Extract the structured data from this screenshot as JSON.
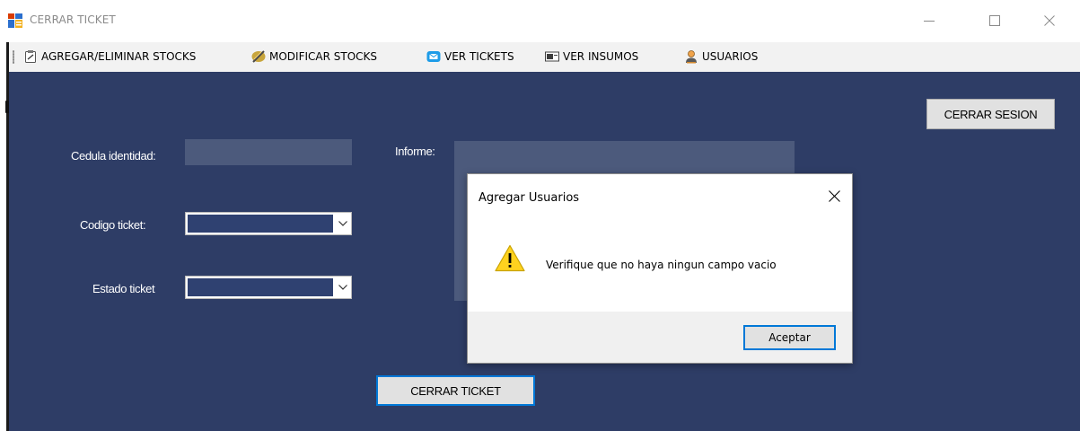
{
  "window": {
    "title": "CERRAR TICKET",
    "accent_color": "#0078d7",
    "panel_color": "#2e3d66"
  },
  "menu": {
    "items": [
      {
        "label": "AGREGAR/ELIMINAR STOCKS",
        "icon": "clipboard-icon"
      },
      {
        "label": "MODIFICAR STOCKS",
        "icon": "pencil-icon"
      },
      {
        "label": "VER TICKETS",
        "icon": "mail-icon"
      },
      {
        "label": "VER INSUMOS",
        "icon": "card-icon"
      },
      {
        "label": "USUARIOS",
        "icon": "user-icon"
      }
    ]
  },
  "form": {
    "cedula_label": "Cedula identidad:",
    "cedula_value": "",
    "codigo_label": "Codigo ticket:",
    "codigo_value": "",
    "estado_label": "Estado ticket",
    "estado_value": "",
    "informe_label": "Informe:",
    "informe_value": "",
    "cerrar_sesion_label": "CERRAR SESION",
    "cerrar_ticket_label": "CERRAR TICKET"
  },
  "dialog": {
    "title": "Agregar Usuarios",
    "message": "Verifique que no haya ningun campo vacio",
    "ok_label": "Aceptar",
    "icon": "warning-icon"
  }
}
